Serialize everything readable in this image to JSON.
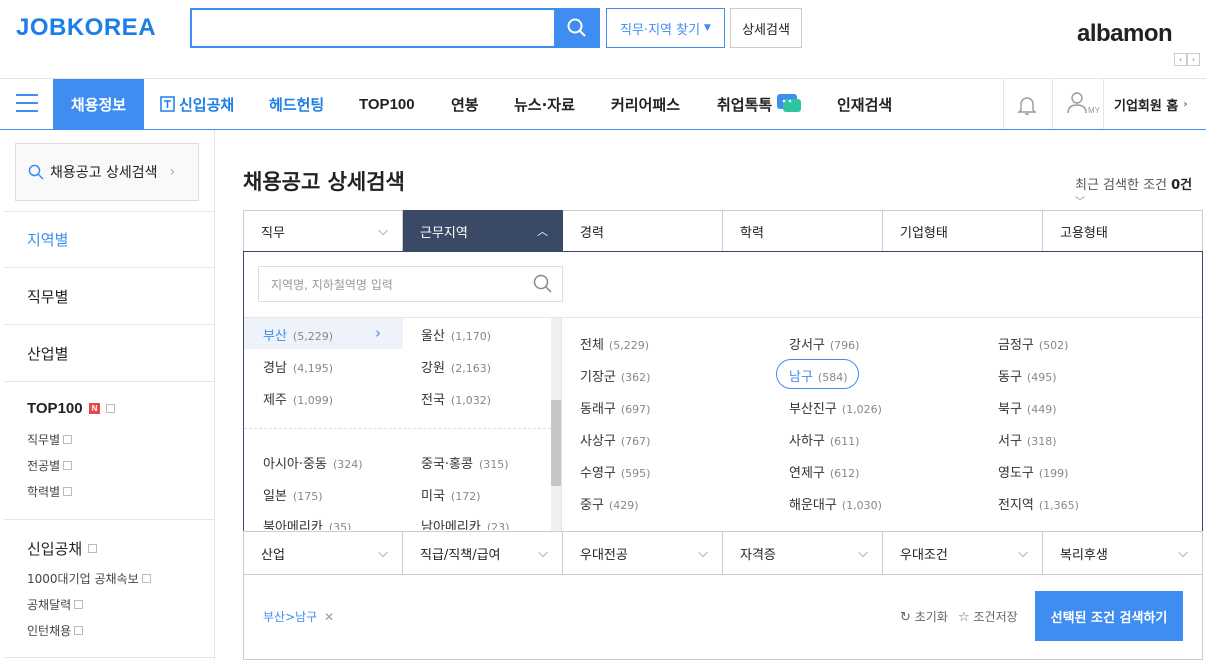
{
  "header": {
    "logo": "JOBKOREA",
    "search_value": "",
    "job_location_btn": "직무·지역 찾기",
    "detail_search_btn": "상세검색",
    "albamon_logo": "albamon"
  },
  "nav": {
    "items": [
      "채용정보",
      "신입공채",
      "헤드헌팅",
      "TOP100",
      "연봉",
      "뉴스·자료",
      "커리어패스",
      "취업톡톡",
      "인재검색"
    ],
    "biz_home": "기업회원 홈",
    "user_label": "MY"
  },
  "sidebar": {
    "search_label": "채용공고 상세검색",
    "categories": [
      "지역별",
      "직무별",
      "산업별"
    ],
    "top100": {
      "label": "TOP100",
      "badge": "N",
      "subs": [
        "직무별",
        "전공별",
        "학력별"
      ]
    },
    "newgrad": {
      "label": "신입공채",
      "subs": [
        "1000대기업 공채속보",
        "공채달력",
        "인턴채용"
      ]
    }
  },
  "main": {
    "title": "채용공고 상세검색",
    "recent_prefix": "최근 검색한 조건 ",
    "recent_count": "0건",
    "tabs": [
      "직무",
      "근무지역",
      "경력",
      "학력",
      "기업형태",
      "고용형태"
    ],
    "tabs2": [
      "산업",
      "직급/직책/급여",
      "우대전공",
      "자격증",
      "우대조건",
      "복리후생"
    ],
    "location_placeholder": "지역명, 지하철역명 입력",
    "regions_col1": [
      {
        "name": "부산",
        "count": "(5,229)"
      },
      {
        "name": "경남",
        "count": "(4,195)"
      },
      {
        "name": "제주",
        "count": "(1,099)"
      },
      {
        "name": "아시아·중동",
        "count": "(324)"
      },
      {
        "name": "일본",
        "count": "(175)"
      },
      {
        "name": "북아메리카",
        "count": "(35)"
      }
    ],
    "regions_col2": [
      {
        "name": "울산",
        "count": "(1,170)"
      },
      {
        "name": "강원",
        "count": "(2,163)"
      },
      {
        "name": "전국",
        "count": "(1,032)"
      },
      {
        "name": "중국·홍콩",
        "count": "(315)"
      },
      {
        "name": "미국",
        "count": "(172)"
      },
      {
        "name": "남아메리카",
        "count": "(23)"
      }
    ],
    "districts": [
      {
        "name": "전체",
        "count": "(5,229)"
      },
      {
        "name": "강서구",
        "count": "(796)"
      },
      {
        "name": "금정구",
        "count": "(502)"
      },
      {
        "name": "기장군",
        "count": "(362)"
      },
      {
        "name": "남구",
        "count": "(584)"
      },
      {
        "name": "동구",
        "count": "(495)"
      },
      {
        "name": "동래구",
        "count": "(697)"
      },
      {
        "name": "부산진구",
        "count": "(1,026)"
      },
      {
        "name": "북구",
        "count": "(449)"
      },
      {
        "name": "사상구",
        "count": "(767)"
      },
      {
        "name": "사하구",
        "count": "(611)"
      },
      {
        "name": "서구",
        "count": "(318)"
      },
      {
        "name": "수영구",
        "count": "(595)"
      },
      {
        "name": "연제구",
        "count": "(612)"
      },
      {
        "name": "영도구",
        "count": "(199)"
      },
      {
        "name": "중구",
        "count": "(429)"
      },
      {
        "name": "해운대구",
        "count": "(1,030)"
      },
      {
        "name": "전지역",
        "count": "(1,365)"
      }
    ],
    "selected_tag": "부산>남구",
    "reset_label": "초기화",
    "save_label": "조건저장",
    "apply_label": "선택된 조건 검색하기"
  },
  "colors": {
    "accent": "#3f8df0",
    "tab_active": "#3a4a66"
  }
}
